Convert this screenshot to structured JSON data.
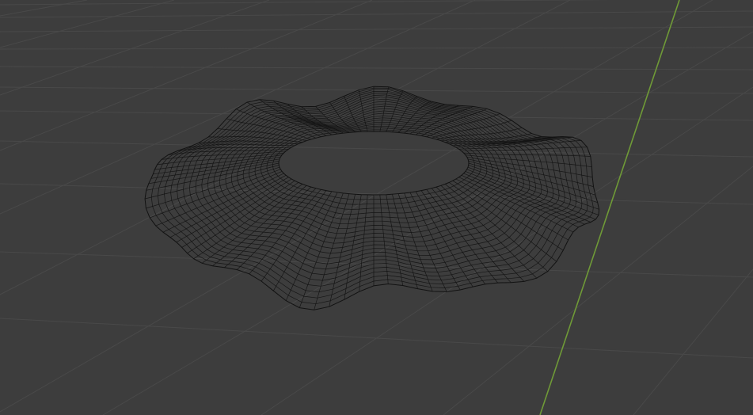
{
  "viewport": {
    "background_color": "#3d3d3d",
    "grid_color": "#494949",
    "y_axis_color": "#6f9a37",
    "wire_color": "#121212",
    "shading_mode": "wireframe",
    "object": "cloth-ring-mesh"
  }
}
